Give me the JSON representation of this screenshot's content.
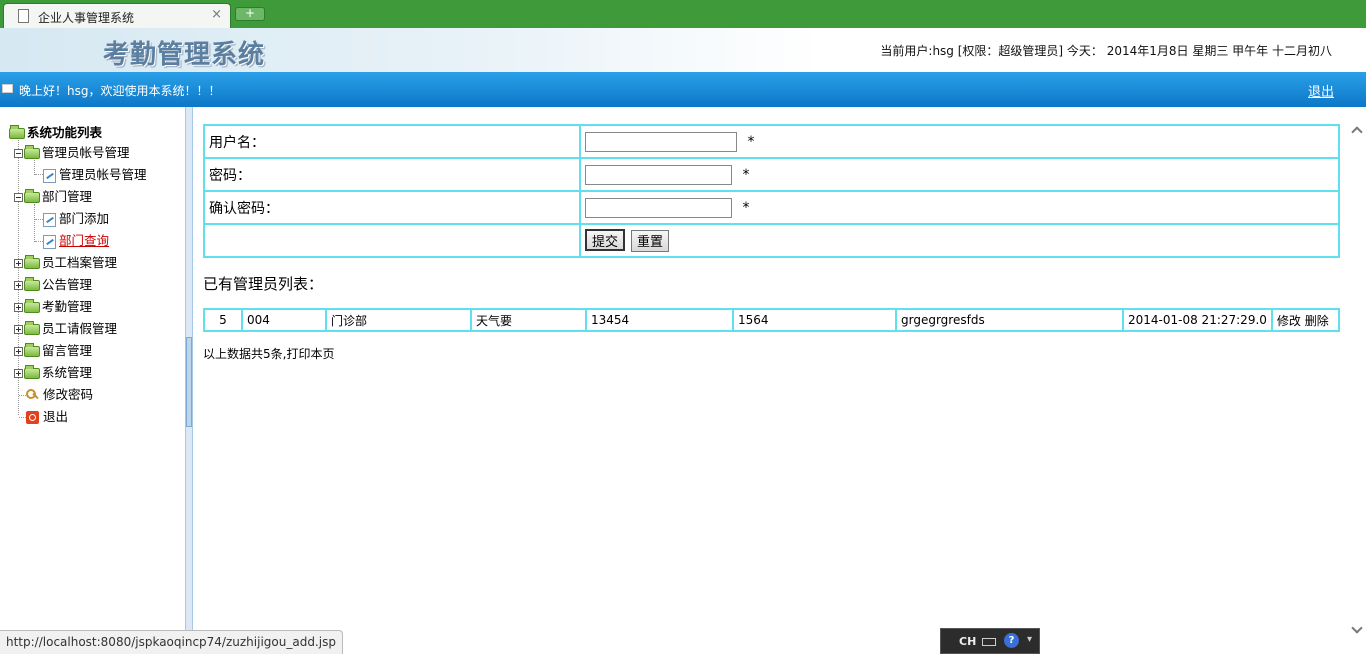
{
  "browser": {
    "tab_title": "企业人事管理系统",
    "close_glyph": "×",
    "newtab_glyph": "+"
  },
  "header": {
    "title": "考勤管理系统",
    "current_user": "当前用户:hsg [权限：超级管理员] 今天： 2014年1月8日 星期三 甲午年 十二月初八"
  },
  "bar": {
    "welcome": "晚上好！hsg，欢迎使用本系统！！！",
    "logout": "退出"
  },
  "sidebar": {
    "root": "系统功能列表",
    "groups": [
      {
        "label": "管理员帐号管理",
        "expanded": true,
        "children": [
          "管理员帐号管理"
        ]
      },
      {
        "label": "部门管理",
        "expanded": true,
        "children": [
          "部门添加",
          "部门查询"
        ]
      },
      {
        "label": "员工档案管理",
        "expanded": false
      },
      {
        "label": "公告管理",
        "expanded": false
      },
      {
        "label": "考勤管理",
        "expanded": false
      },
      {
        "label": "员工请假管理",
        "expanded": false
      },
      {
        "label": "留言管理",
        "expanded": false
      },
      {
        "label": "系统管理",
        "expanded": false
      }
    ],
    "change_password": "修改密码",
    "exit": "退出",
    "active_item": "部门查询"
  },
  "form": {
    "username_label": "用户名：",
    "password_label": "密码：",
    "confirm_label": "确认密码：",
    "username_value": "",
    "password_value": "",
    "confirm_value": "",
    "required_mark": "*",
    "submit": "提交",
    "reset": "重置"
  },
  "list": {
    "title": "已有管理员列表：",
    "rows": [
      {
        "no": "5",
        "c1": "004",
        "c2": "门诊部",
        "c3": "天气要",
        "c4": "13454",
        "c5": "1564",
        "c6": "grgegrgresfds",
        "c7": "2014-01-08 21:27:29.0",
        "edit": "修改",
        "delete": "删除"
      }
    ],
    "summary": "以上数据共5条,打印本页"
  },
  "status": {
    "url": "http://localhost:8080/jspkaoqincp74/zuzhijigou_add.jsp"
  },
  "ime": {
    "mode": "CH",
    "help": "?",
    "options": "▾"
  },
  "colors": {
    "tabbar": "#3f9a3a",
    "bluebar": "#1a8ad8",
    "table_border": "#5fe0ec",
    "active_link": "#cc0000"
  }
}
